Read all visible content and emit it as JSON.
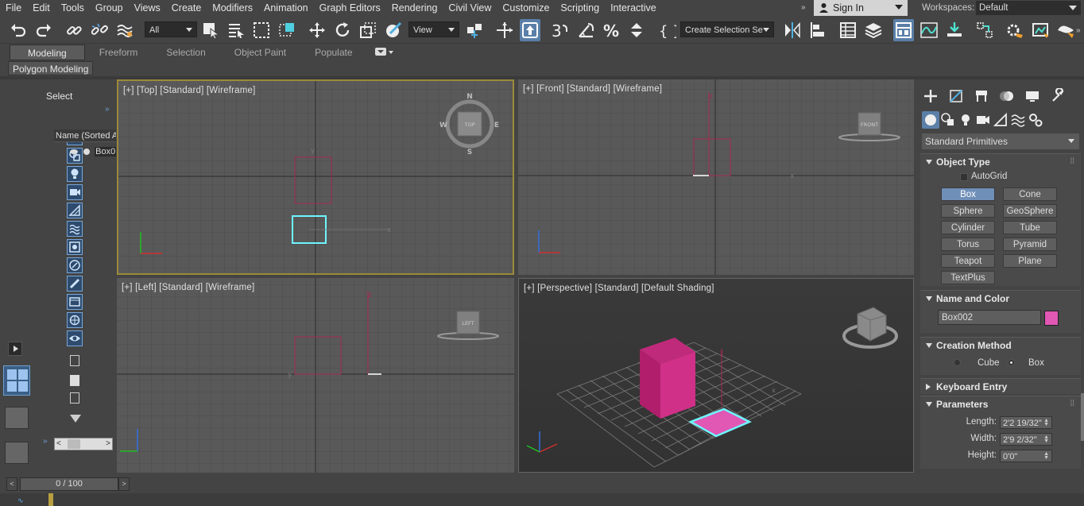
{
  "menu": [
    "File",
    "Edit",
    "Tools",
    "Group",
    "Views",
    "Create",
    "Modifiers",
    "Animation",
    "Graph Editors",
    "Rendering",
    "Civil View",
    "Customize",
    "Scripting",
    "Interactive"
  ],
  "signin": "Sign In",
  "workspaces": {
    "label": "Workspaces:",
    "value": "Default"
  },
  "toolbar": {
    "selection_filter": "All",
    "ref_coord": "View",
    "selection_set": "Create Selection Se"
  },
  "ribbon": {
    "tabs": [
      "Modeling",
      "Freeform",
      "Selection",
      "Object Paint",
      "Populate"
    ],
    "active": "Modeling",
    "sub": "Polygon Modeling"
  },
  "scene_explorer": {
    "title": "Select",
    "column": "Name (Sorted A",
    "item": "Box0"
  },
  "viewports": {
    "top": {
      "label": "[+] [Top] [Standard] [Wireframe]",
      "cube_face": "TOP",
      "compass": [
        "N",
        "S",
        "E",
        "W"
      ]
    },
    "front": {
      "label": "[+] [Front] [Standard] [Wireframe]",
      "cube_face": "FRONT"
    },
    "left": {
      "label": "[+] [Left] [Standard] [Wireframe]",
      "cube_face": "LEFT"
    },
    "persp": {
      "label": "[+] [Perspective] [Standard] [Default Shading]"
    }
  },
  "command_panel": {
    "category": "Standard Primitives",
    "object_type": {
      "title": "Object Type",
      "autogrid": "AutoGrid",
      "buttons": [
        "Box",
        "Cone",
        "Sphere",
        "GeoSphere",
        "Cylinder",
        "Tube",
        "Torus",
        "Pyramid",
        "Teapot",
        "Plane",
        "TextPlus"
      ],
      "selected": "Box"
    },
    "name_color": {
      "title": "Name and Color",
      "name": "Box002",
      "color": "#e057b4"
    },
    "creation": {
      "title": "Creation Method",
      "options": [
        "Cube",
        "Box"
      ],
      "selected": "Box"
    },
    "keyboard": {
      "title": "Keyboard Entry"
    },
    "params": {
      "title": "Parameters",
      "length_label": "Length:",
      "length": "2'2 19/32\"",
      "width_label": "Width:",
      "width": "2'9 2/32\"",
      "height_label": "Height:",
      "height": "0'0\""
    }
  },
  "timeline": {
    "frame": "0 / 100"
  },
  "colors": {
    "accent": "#e057b4",
    "selection": "#6f8fb8",
    "highlight": "#5ff2ff"
  }
}
